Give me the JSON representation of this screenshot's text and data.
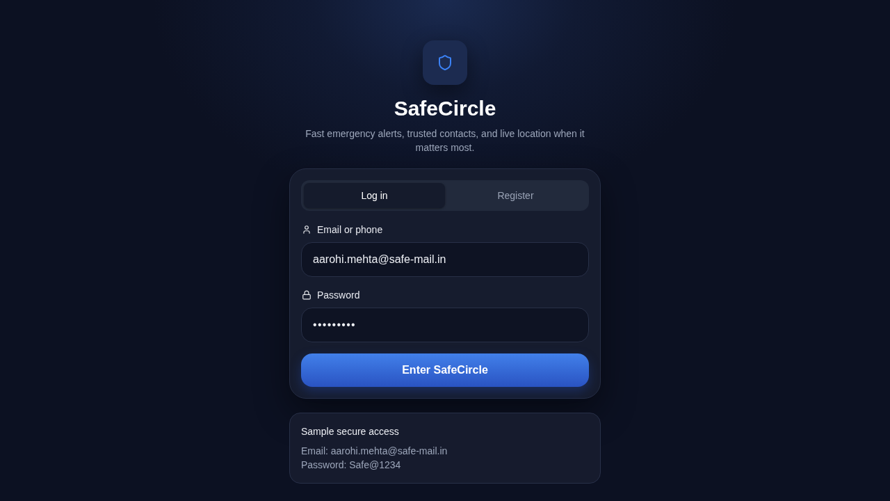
{
  "brand": {
    "name": "SafeCircle",
    "tagline": "Fast emergency alerts, trusted contacts, and live location when it matters most."
  },
  "tabs": [
    {
      "label": "Log in",
      "selected": true
    },
    {
      "label": "Register",
      "selected": false
    }
  ],
  "fields": [
    {
      "kind": "text",
      "label": "Email or phone",
      "value": "aarohi.mehta@safe-mail.in"
    },
    {
      "kind": "password",
      "label": "Password",
      "value": "•••••••••"
    }
  ],
  "submit_button": {
    "label": "Enter SafeCircle"
  },
  "sample_access": {
    "title": "Sample secure access",
    "lines": [
      "Email: aarohi.mehta@safe-mail.in",
      "Password: Safe@1234"
    ]
  }
}
